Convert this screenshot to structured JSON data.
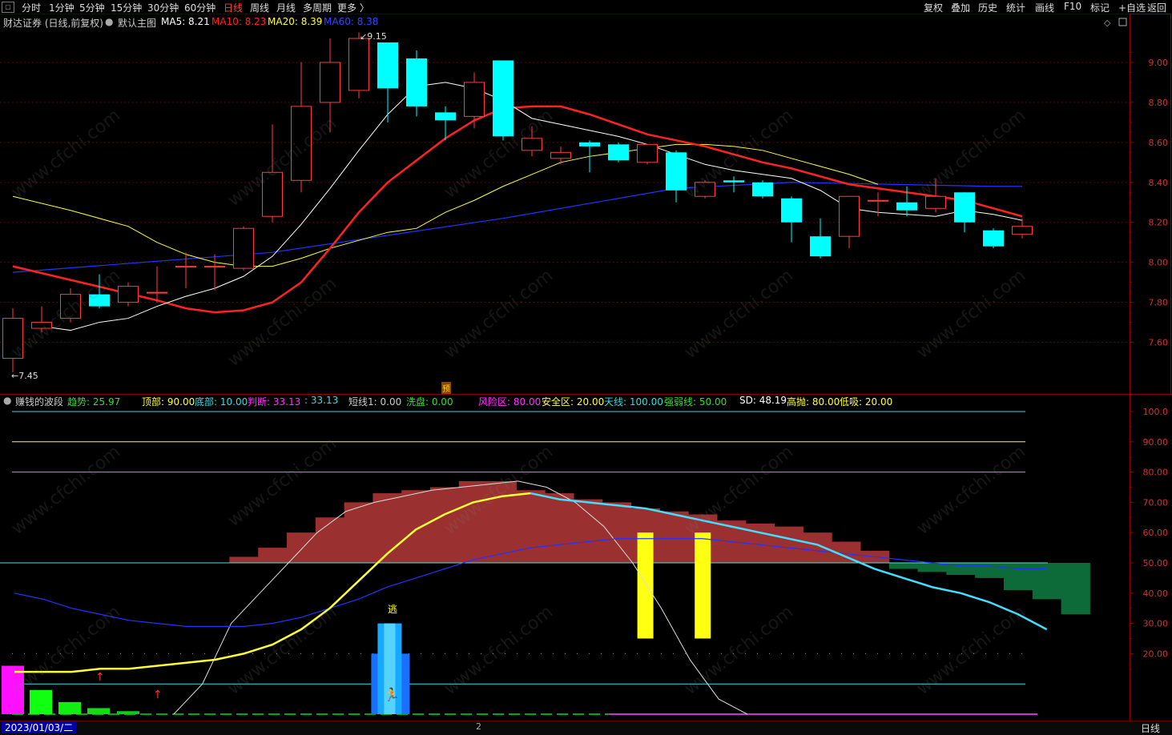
{
  "toolbar": {
    "left_items": [
      "分时",
      "1分钟",
      "5分钟",
      "15分钟",
      "30分钟",
      "60分钟",
      "日线",
      "周线",
      "月线",
      "多周期",
      "更多 〉"
    ],
    "active": "日线",
    "right_items": [
      "复权",
      "叠加",
      "历史",
      "统计",
      "画线",
      "F10",
      "标记",
      "+自选",
      "返回"
    ]
  },
  "main_header": {
    "title": "财达证券 (日线,前复权)",
    "template": "默认主图",
    "ma": [
      {
        "label": "MA5: 8.21",
        "color": "#ffffff"
      },
      {
        "label": "MA10: 8.23",
        "color": "#ff2222"
      },
      {
        "label": "MA20: 8.39",
        "color": "#ffff33"
      },
      {
        "label": "MA60: 8.38",
        "color": "#2233ff"
      }
    ]
  },
  "annotations": {
    "high": "9.15",
    "low": "7.45",
    "marker_yu": "预",
    "escape": "逃",
    "bottom_page": "2"
  },
  "sub_header": {
    "title": "赚钱的波段",
    "items": [
      {
        "label": "趋势: 25.97",
        "color": "#33dd33"
      },
      {
        "label": "顶部: 90.00",
        "color": "#ffff33"
      },
      {
        "label": "底部: 10.00",
        "color": "#33dddd"
      },
      {
        "label": "判断: 33.13",
        "color": "#ff33ff"
      },
      {
        "label": ": 33.13",
        "color": "#33dddd"
      },
      {
        "label": "短线1: 0.00",
        "color": "#cccccc"
      },
      {
        "label": "洗盘: 0.00",
        "color": "#33dd33"
      },
      {
        "label": "风险区: 80.00",
        "color": "#ff33ff"
      },
      {
        "label": "安全区: 20.00",
        "color": "#ffff33"
      },
      {
        "label": "天线: 100.00",
        "color": "#33dddd"
      },
      {
        "label": "强弱线: 50.00",
        "color": "#33dd33"
      },
      {
        "label": "SD: 48.19",
        "color": "#ffffff"
      },
      {
        "label": "高抛: 80.00",
        "color": "#ffff33"
      },
      {
        "label": "低吸: 20.00",
        "color": "#ffff33"
      }
    ]
  },
  "bottom": {
    "date": "2023/01/03/二",
    "period": "日线"
  },
  "watermark": "www.cfchi.com",
  "colors": {
    "up": "#ff3b3b",
    "down": "#00ffff",
    "ma5": "#ffffff",
    "ma10": "#ff2222",
    "ma20": "#ffff33",
    "ma60": "#2233ff",
    "frame": "#8b0000"
  },
  "chart_data": [
    {
      "type": "candlestick",
      "ylim": [
        7.45,
        9.25
      ],
      "y_ticks": [
        "9.00",
        "8.80",
        "8.60",
        "8.40",
        "8.20",
        "8.00",
        "7.80",
        "7.60"
      ],
      "candles": [
        {
          "o": 7.52,
          "c": 7.72,
          "h": 7.77,
          "l": 7.45
        },
        {
          "o": 7.67,
          "c": 7.7,
          "h": 7.78,
          "l": 7.65
        },
        {
          "o": 7.72,
          "c": 7.84,
          "h": 7.87,
          "l": 7.7
        },
        {
          "o": 7.84,
          "c": 7.78,
          "h": 7.94,
          "l": 7.77
        },
        {
          "o": 7.8,
          "c": 7.88,
          "h": 7.9,
          "l": 7.78
        },
        {
          "o": 7.85,
          "c": 7.85,
          "h": 7.98,
          "l": 7.8
        },
        {
          "o": 7.98,
          "c": 7.98,
          "h": 8.05,
          "l": 7.87
        },
        {
          "o": 7.98,
          "c": 7.98,
          "h": 8.04,
          "l": 7.86
        },
        {
          "o": 7.97,
          "c": 8.17,
          "h": 8.18,
          "l": 7.96
        },
        {
          "o": 8.23,
          "c": 8.45,
          "h": 8.69,
          "l": 8.2
        },
        {
          "o": 8.41,
          "c": 8.78,
          "h": 9.0,
          "l": 8.35
        },
        {
          "o": 8.8,
          "c": 9.0,
          "h": 9.12,
          "l": 8.65
        },
        {
          "o": 8.86,
          "c": 9.12,
          "h": 9.15,
          "l": 8.82
        },
        {
          "o": 9.1,
          "c": 8.87,
          "h": 9.1,
          "l": 8.7
        },
        {
          "o": 9.02,
          "c": 8.78,
          "h": 9.06,
          "l": 8.73
        },
        {
          "o": 8.75,
          "c": 8.71,
          "h": 8.78,
          "l": 8.61
        },
        {
          "o": 8.73,
          "c": 8.9,
          "h": 8.95,
          "l": 8.67
        },
        {
          "o": 9.01,
          "c": 8.63,
          "h": 9.01,
          "l": 8.61
        },
        {
          "o": 8.56,
          "c": 8.62,
          "h": 8.68,
          "l": 8.53
        },
        {
          "o": 8.52,
          "c": 8.55,
          "h": 8.58,
          "l": 8.49
        },
        {
          "o": 8.6,
          "c": 8.58,
          "h": 8.61,
          "l": 8.45
        },
        {
          "o": 8.59,
          "c": 8.51,
          "h": 8.6,
          "l": 8.5
        },
        {
          "o": 8.5,
          "c": 8.59,
          "h": 8.59,
          "l": 8.49
        },
        {
          "o": 8.55,
          "c": 8.36,
          "h": 8.56,
          "l": 8.3
        },
        {
          "o": 8.33,
          "c": 8.4,
          "h": 8.41,
          "l": 8.32
        },
        {
          "o": 8.41,
          "c": 8.4,
          "h": 8.43,
          "l": 8.35
        },
        {
          "o": 8.4,
          "c": 8.33,
          "h": 8.41,
          "l": 8.32
        },
        {
          "o": 8.32,
          "c": 8.2,
          "h": 8.33,
          "l": 8.1
        },
        {
          "o": 8.13,
          "c": 8.03,
          "h": 8.22,
          "l": 8.02
        },
        {
          "o": 8.13,
          "c": 8.33,
          "h": 8.33,
          "l": 8.07
        },
        {
          "o": 8.31,
          "c": 8.31,
          "h": 8.35,
          "l": 8.23
        },
        {
          "o": 8.3,
          "c": 8.26,
          "h": 8.38,
          "l": 8.23
        },
        {
          "o": 8.27,
          "c": 8.33,
          "h": 8.42,
          "l": 8.25
        },
        {
          "o": 8.35,
          "c": 8.2,
          "h": 8.35,
          "l": 8.15
        },
        {
          "o": 8.16,
          "c": 8.08,
          "h": 8.17,
          "l": 8.07
        },
        {
          "o": 8.14,
          "c": 8.18,
          "h": 8.22,
          "l": 8.12
        }
      ],
      "ma5": [
        null,
        7.68,
        7.66,
        7.7,
        7.72,
        7.78,
        7.83,
        7.87,
        7.93,
        8.03,
        8.19,
        8.37,
        8.56,
        8.74,
        8.88,
        8.9,
        8.87,
        8.81,
        8.72,
        8.69,
        8.66,
        8.63,
        8.59,
        8.54,
        8.49,
        8.46,
        8.44,
        8.42,
        8.36,
        8.27,
        8.25,
        8.24,
        8.23,
        8.26,
        8.24,
        8.21
      ],
      "ma10": [
        7.98,
        null,
        null,
        null,
        null,
        7.81,
        7.77,
        7.75,
        7.76,
        7.8,
        7.9,
        8.07,
        8.25,
        8.4,
        8.51,
        8.62,
        8.71,
        8.77,
        8.78,
        8.78,
        8.74,
        8.69,
        8.64,
        8.61,
        8.58,
        8.54,
        8.5,
        8.47,
        8.43,
        8.39,
        8.37,
        8.35,
        8.33,
        8.31,
        8.27,
        8.23
      ],
      "ma20": [
        8.33,
        null,
        8.26,
        null,
        8.18,
        8.1,
        8.04,
        8.0,
        7.98,
        7.98,
        8.02,
        8.07,
        8.11,
        8.15,
        8.17,
        8.25,
        8.31,
        8.38,
        8.44,
        8.5,
        8.53,
        8.55,
        8.57,
        8.59,
        8.59,
        8.58,
        8.56,
        8.52,
        8.48,
        8.44,
        8.39
      ],
      "ma60": [
        7.95,
        null,
        null,
        null,
        null,
        null,
        null,
        null,
        null,
        8.05,
        null,
        null,
        null,
        null,
        null,
        null,
        null,
        8.22,
        null,
        null,
        null,
        null,
        null,
        8.37,
        null,
        null,
        null,
        8.4,
        null,
        null,
        null,
        null,
        null,
        null,
        8.38,
        8.38
      ]
    },
    {
      "type": "indicator",
      "name": "赚钱的波段",
      "ylim": [
        0,
        105
      ],
      "y_ticks": [
        "100.0",
        "90.00",
        "80.00",
        "70.00",
        "60.00",
        "50.00",
        "40.00",
        "30.00",
        "20.00"
      ],
      "hlines": {
        "天线": 100,
        "顶部": 90,
        "风险区": 80,
        "强弱线": 50,
        "底部": 10
      },
      "histogram": [
        50,
        50,
        50,
        50,
        50,
        50,
        50,
        50,
        52,
        55,
        60,
        65,
        70,
        73,
        74,
        75,
        77,
        77,
        74,
        73,
        71,
        70,
        68,
        67,
        66,
        64,
        63,
        62,
        60,
        57,
        54,
        48,
        47,
        46,
        45,
        41,
        38,
        33
      ],
      "yellow_line": [
        14,
        14,
        14,
        15,
        15,
        16,
        17,
        18,
        20,
        23,
        28,
        35,
        44,
        53,
        61,
        66,
        70,
        72,
        73,
        71,
        70,
        69,
        68,
        66,
        64,
        62,
        60,
        58,
        56,
        52,
        48,
        45,
        42,
        40,
        37,
        33,
        28
      ],
      "cyan_line_from": 18,
      "blue_line": [
        40,
        38,
        35,
        33,
        31,
        30,
        29,
        29,
        29,
        30,
        32,
        35,
        38,
        42,
        45,
        48,
        51,
        53,
        55,
        56,
        57,
        58,
        58,
        58,
        58,
        57,
        56,
        55,
        54,
        53,
        52,
        51,
        50,
        49,
        49,
        48,
        48
      ],
      "white_line": [
        null,
        null,
        null,
        null,
        null,
        null,
        0,
        10,
        30,
        40,
        50,
        60,
        67,
        70,
        72,
        74,
        75,
        76,
        77,
        75,
        70,
        62,
        50,
        35,
        18,
        5,
        0
      ],
      "yellow_bars": [
        22,
        24
      ],
      "blue_bar": 13
    }
  ]
}
